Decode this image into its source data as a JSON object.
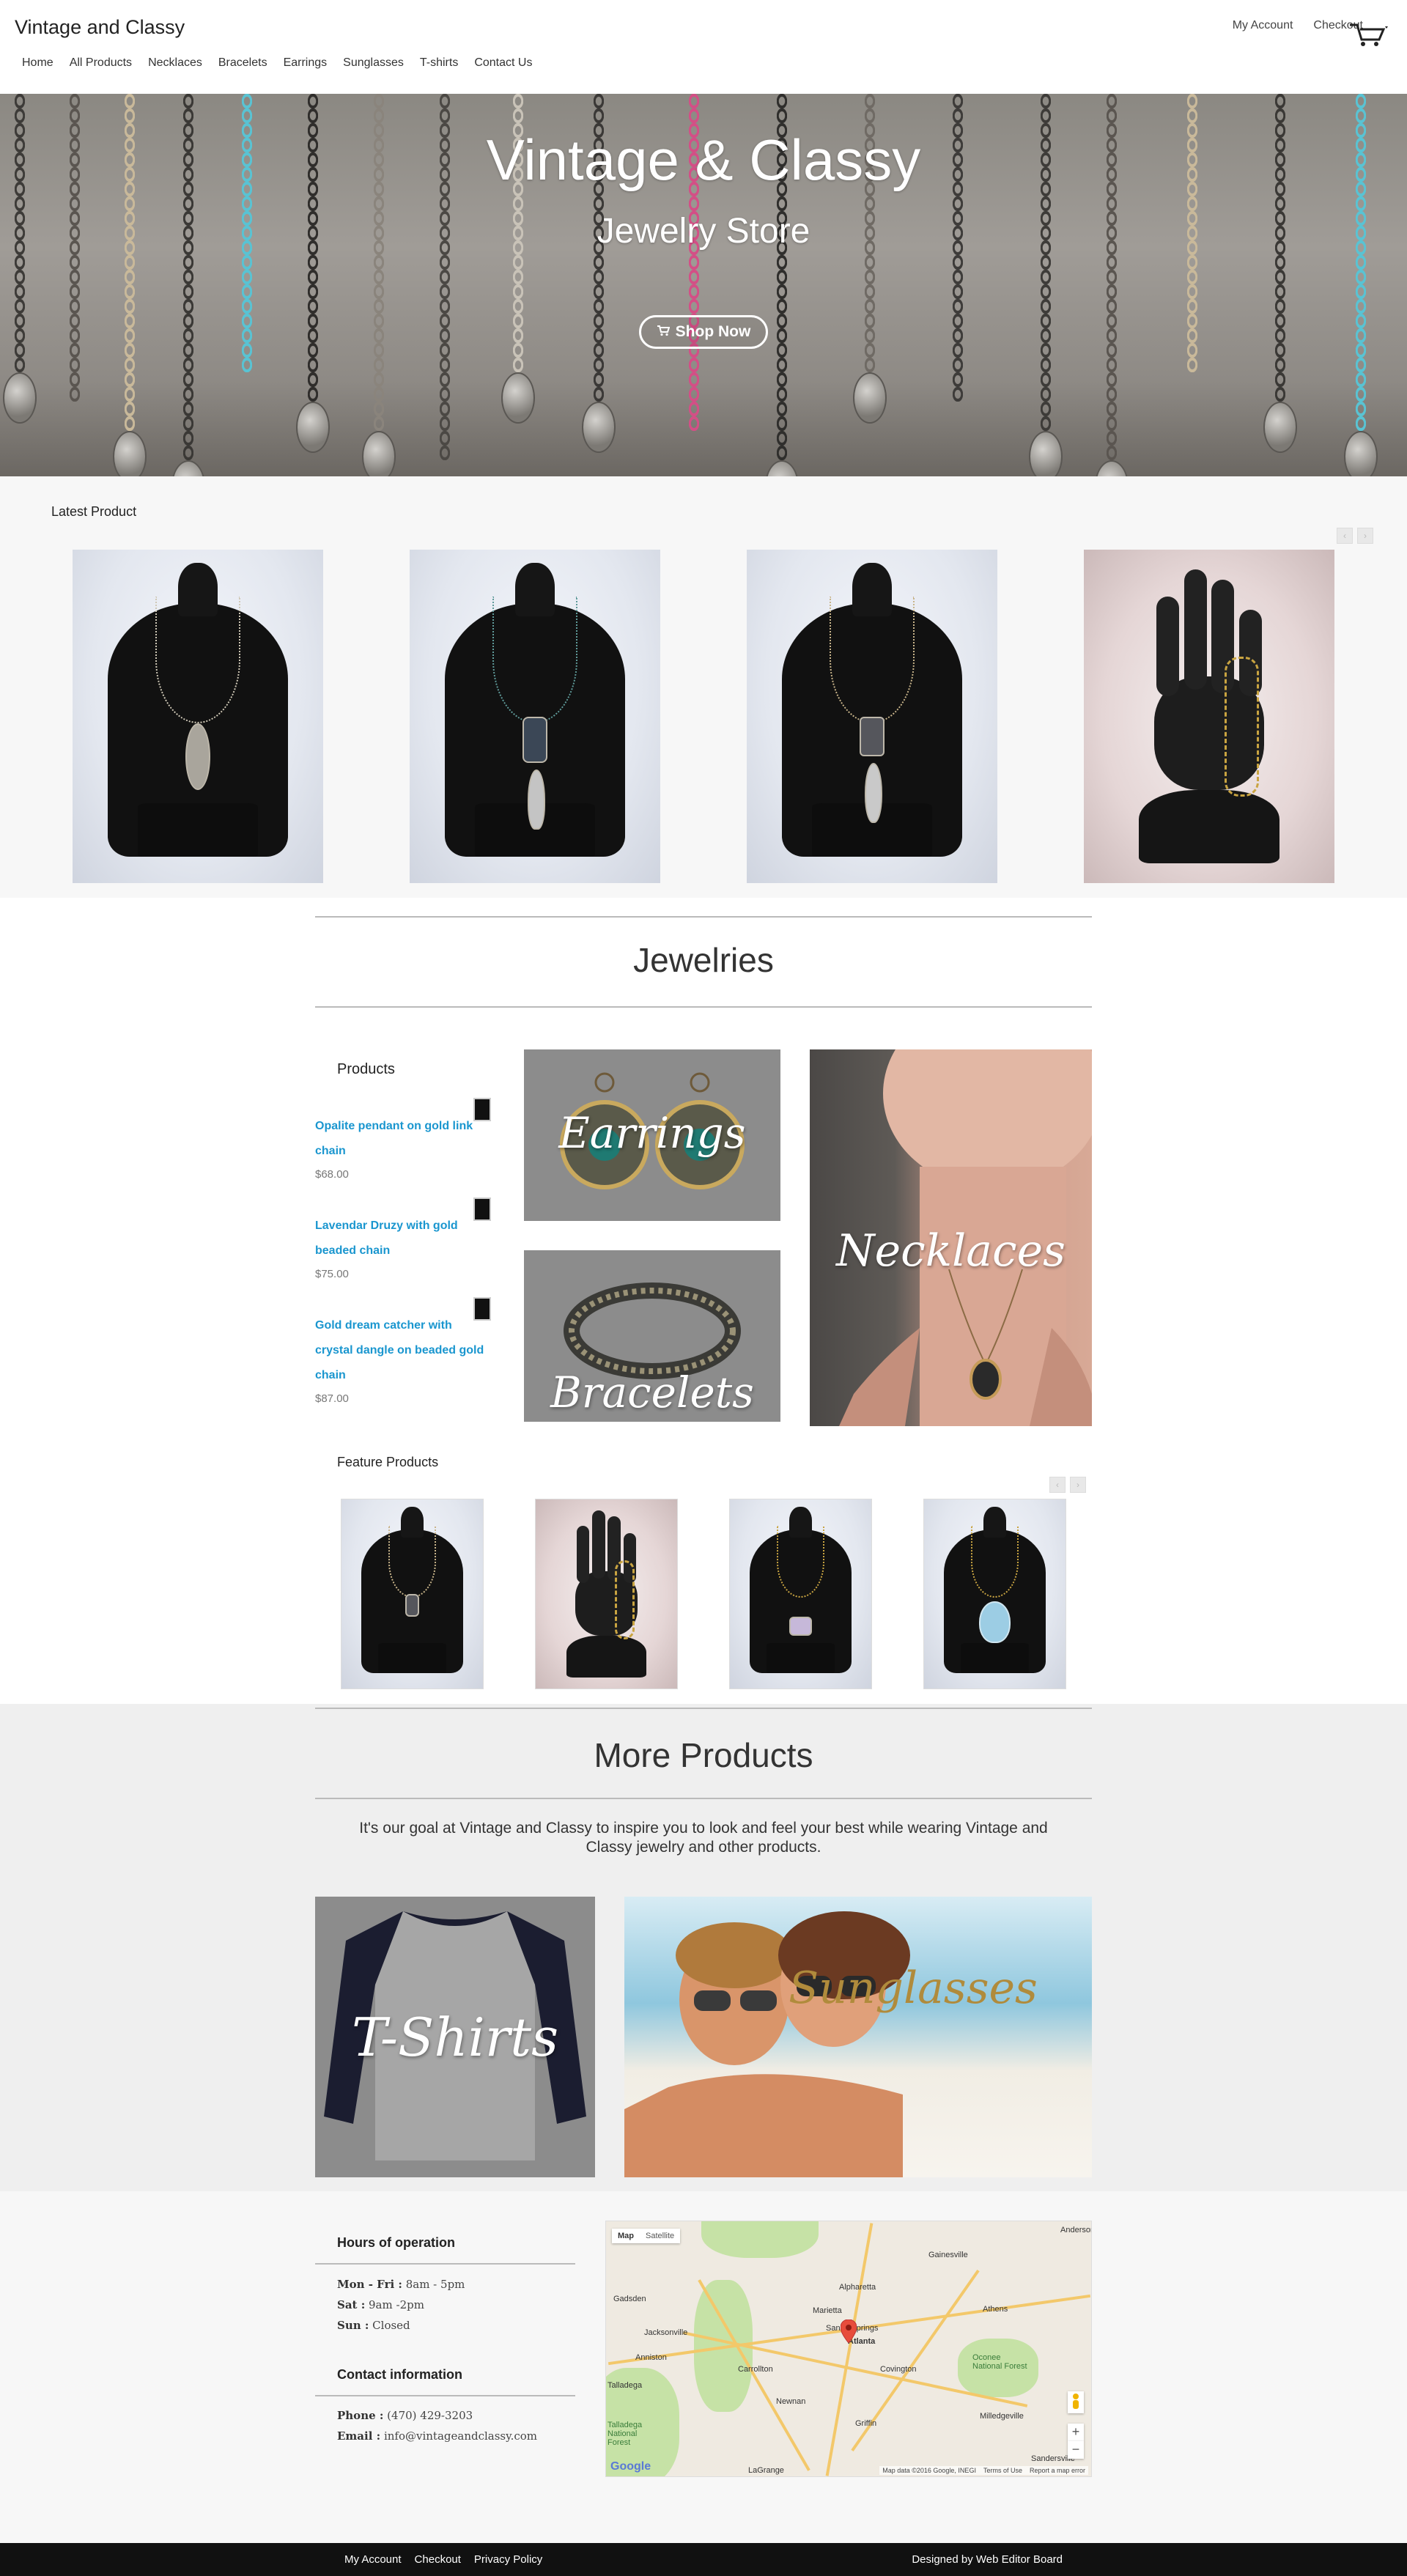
{
  "header": {
    "site_title": "Vintage and Classy",
    "my_account": "My Account",
    "checkout": "Checkout",
    "nav": [
      "Home",
      "All Products",
      "Necklaces",
      "Bracelets",
      "Earrings",
      "Sunglasses",
      "T-shirts",
      "Contact Us"
    ]
  },
  "hero": {
    "title": "Vintage & Classy",
    "subtitle": "Jewelry Store",
    "button": "Shop Now"
  },
  "latest": {
    "title": "Latest Product",
    "prev": "‹",
    "next": "›"
  },
  "jewelries": {
    "title": "Jewelries",
    "products_heading": "Products",
    "products": [
      {
        "name_line1": "Opalite pendant on gold link",
        "name_line2": "chain",
        "name_line3": "",
        "price": "$68.00"
      },
      {
        "name_line1": "Lavendar Druzy with gold",
        "name_line2": "beaded chain",
        "name_line3": "",
        "price": "$75.00"
      },
      {
        "name_line1": "Gold dream catcher with",
        "name_line2": "crystal dangle on beaded gold",
        "name_line3": "chain",
        "price": "$87.00"
      }
    ],
    "tiles": {
      "earrings": "Earrings",
      "bracelets": "Bracelets",
      "necklaces": "Necklaces"
    }
  },
  "feature": {
    "title": "Feature Products"
  },
  "more": {
    "title": "More Products",
    "text": "It's our goal at Vintage and Classy to inspire you to look and feel your best while wearing Vintage and Classy jewelry and other products.",
    "tshirts": "T-Shirts",
    "sunglasses": "Sunglasses"
  },
  "info": {
    "hours_title": "Hours of operation",
    "hours": [
      {
        "day": "Mon - Fri :",
        "time": " 8am - 5pm"
      },
      {
        "day": "Sat :",
        "time": " 9am -2pm"
      },
      {
        "day": "Sun :",
        "time": " Closed"
      }
    ],
    "contact_title": "Contact information",
    "phone_label": "Phone :",
    "phone": " (470) 429-3203",
    "email_label": "Email :",
    "email": " info@vintageandclassy.com"
  },
  "map": {
    "tab_map": "Map",
    "tab_satellite": "Satellite",
    "cities": [
      "Gainesville",
      "Alpharetta",
      "Athens",
      "Marietta",
      "Sandy Springs",
      "Atlanta",
      "Gadsden",
      "Jacksonville",
      "Anniston",
      "Carrollton",
      "Covington",
      "Newnan",
      "Griffin",
      "LaGrange",
      "Milledgeville",
      "Oconee National Forest",
      "Talladega",
      "Anderson",
      "Sandersville",
      "Talladega National Forest"
    ],
    "attribution": "Map data ©2016 Google, INEGI",
    "terms": "Terms of Use",
    "report": "Report a map error",
    "google": "Google"
  },
  "footer": {
    "links": [
      "My Account",
      "Checkout",
      "Privacy Policy"
    ],
    "designed_by": "Designed by",
    "designer": "Web Editor Board"
  }
}
